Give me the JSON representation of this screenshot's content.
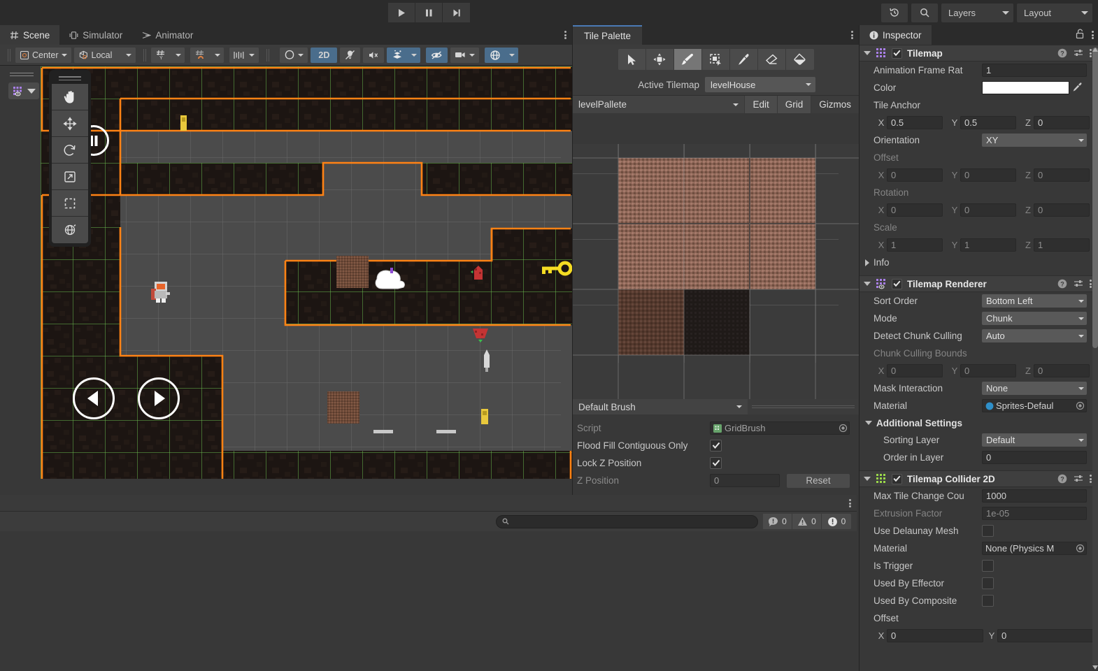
{
  "topbar": {
    "play_label": "Play",
    "pause_label": "Pause",
    "step_label": "Step",
    "history_icon": "history-icon",
    "search_icon": "search-icon",
    "layers_label": "Layers",
    "layout_label": "Layout"
  },
  "scene_panel": {
    "tabs": [
      {
        "label": "Scene",
        "icon": "grid-icon",
        "active": true
      },
      {
        "label": "Simulator",
        "icon": "device-icon",
        "active": false
      },
      {
        "label": "Animator",
        "icon": "animator-icon",
        "active": false
      }
    ],
    "toolbar": {
      "pivot_label": "Center",
      "space_label": "Local",
      "grid_snap_icon": "grid-snap-icon",
      "grid_magnet_icon": "grid-magnet-icon",
      "ruler_icon": "ruler-icon",
      "shading_icon": "shading-mode-icon",
      "two_d_label": "2D",
      "light_icon": "light-icon",
      "audio_icon": "audio-mute-icon",
      "fx_icon": "effects-icon",
      "hidden_icon": "scene-visibility-icon",
      "camera_icon": "camera-icon",
      "gizmos_icon": "gizmos-icon"
    },
    "overlay_tools": [
      {
        "name": "hand-tool",
        "label": "Hand"
      },
      {
        "name": "move-tool",
        "label": "Move"
      },
      {
        "name": "rotate-tool",
        "label": "Rotate"
      },
      {
        "name": "scale-tool",
        "label": "Scale"
      },
      {
        "name": "rect-tool",
        "label": "Rect"
      },
      {
        "name": "transform-tool",
        "label": "Transform"
      }
    ],
    "layer_dropdown_icon": "tilemap-layer-icon"
  },
  "console_panel": {
    "search_placeholder": "",
    "log_count": "0",
    "warning_count": "0",
    "error_count": "0"
  },
  "tile_palette": {
    "tab_label": "Tile Palette",
    "tools": [
      {
        "name": "select-tool",
        "selected": false
      },
      {
        "name": "move-tool",
        "selected": false
      },
      {
        "name": "paint-brush-tool",
        "selected": true
      },
      {
        "name": "box-fill-tool",
        "selected": false
      },
      {
        "name": "picker-tool",
        "selected": false
      },
      {
        "name": "eraser-tool",
        "selected": false
      },
      {
        "name": "fill-tool",
        "selected": false
      }
    ],
    "active_tilemap_label": "Active Tilemap",
    "active_tilemap_value": "levelHouse",
    "palette_value": "levelPallete",
    "edit_label": "Edit",
    "grid_label": "Grid",
    "gizmos_label": "Gizmos",
    "brush_value": "Default Brush",
    "script_label": "Script",
    "script_value": "GridBrush",
    "flood_fill_label": "Flood Fill Contiguous Only",
    "flood_fill_checked": true,
    "lock_z_label": "Lock Z Position",
    "lock_z_checked": true,
    "z_position_label": "Z Position",
    "z_position_value": "0",
    "reset_label": "Reset"
  },
  "inspector": {
    "tab_label": "Inspector",
    "lock_icon": "lock-icon",
    "menu_icon": "kebab-menu-icon",
    "components": [
      {
        "name": "Tilemap",
        "enabled": true,
        "icon_color": "#a97fe8",
        "rows": [
          {
            "label": "Animation Frame Rat",
            "type": "field",
            "value": "1"
          },
          {
            "label": "Color",
            "type": "color",
            "value": "#ffffff"
          },
          {
            "label": "Tile Anchor",
            "type": "header"
          },
          {
            "label": "",
            "type": "vec3",
            "x": "0.5",
            "y": "0.5",
            "z": "0"
          },
          {
            "label": "Orientation",
            "type": "dropdown",
            "value": "XY"
          },
          {
            "label": "Offset",
            "type": "header",
            "dim": true
          },
          {
            "label": "",
            "type": "vec3",
            "x": "0",
            "y": "0",
            "z": "0",
            "dim": true
          },
          {
            "label": "Rotation",
            "type": "header",
            "dim": true
          },
          {
            "label": "",
            "type": "vec3",
            "x": "0",
            "y": "0",
            "z": "0",
            "dim": true
          },
          {
            "label": "Scale",
            "type": "header",
            "dim": true
          },
          {
            "label": "",
            "type": "vec3",
            "x": "1",
            "y": "1",
            "z": "1",
            "dim": true
          },
          {
            "label": "Info",
            "type": "foldout"
          }
        ]
      },
      {
        "name": "Tilemap Renderer",
        "enabled": true,
        "icon_color": "#a97fe8",
        "rows": [
          {
            "label": "Sort Order",
            "type": "dropdown",
            "value": "Bottom Left"
          },
          {
            "label": "Mode",
            "type": "dropdown",
            "value": "Chunk"
          },
          {
            "label": "Detect Chunk Culling",
            "type": "dropdown",
            "value": "Auto"
          },
          {
            "label": "Chunk Culling Bounds",
            "type": "header",
            "dim": true
          },
          {
            "label": "",
            "type": "vec3",
            "x": "0",
            "y": "0",
            "z": "0",
            "dim": true
          },
          {
            "label": "Mask Interaction",
            "type": "dropdown",
            "value": "None"
          },
          {
            "label": "Material",
            "type": "object",
            "value": "Sprites-Defaul"
          },
          {
            "label": "Additional Settings",
            "type": "subheader"
          },
          {
            "label": "Sorting Layer",
            "type": "dropdown",
            "value": "Default",
            "indent": true
          },
          {
            "label": "Order in Layer",
            "type": "field",
            "value": "0",
            "indent": true
          }
        ]
      },
      {
        "name": "Tilemap Collider 2D",
        "enabled": true,
        "icon_color": "#9ad84a",
        "rows": [
          {
            "label": "Max Tile Change Cou",
            "type": "field",
            "value": "1000"
          },
          {
            "label": "Extrusion Factor",
            "type": "field",
            "value": "1e-05",
            "dim": true
          },
          {
            "label": "Use Delaunay Mesh",
            "type": "checkbox",
            "checked": false
          },
          {
            "label": "Material",
            "type": "object",
            "value": "None (Physics M"
          },
          {
            "label": "Is Trigger",
            "type": "checkbox",
            "checked": false
          },
          {
            "label": "Used By Effector",
            "type": "checkbox",
            "checked": false
          },
          {
            "label": "Used By Composite",
            "type": "checkbox",
            "checked": false
          },
          {
            "label": "Offset",
            "type": "header"
          },
          {
            "label": "",
            "type": "vec2",
            "x": "0",
            "y": "0"
          }
        ]
      }
    ]
  }
}
